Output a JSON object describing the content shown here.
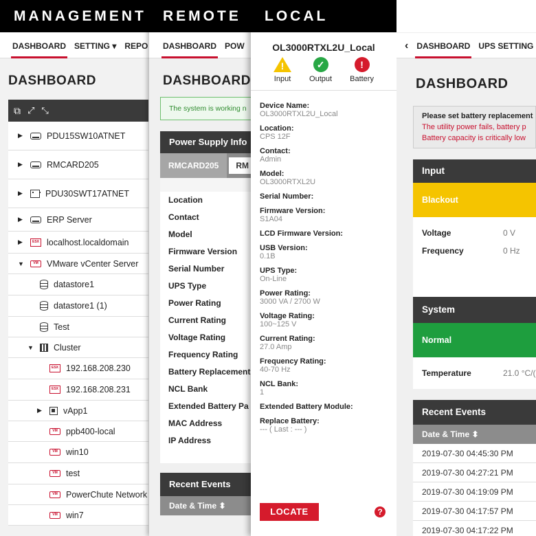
{
  "management": {
    "title": "MANAGEMENT",
    "nav": [
      "DASHBOARD",
      "SETTING ▾",
      "REPO"
    ],
    "heading": "DASHBOARD",
    "tree": [
      {
        "label": "PDU15SW10ATNET",
        "icon": "server-icon",
        "caret": "▶",
        "indent": 0,
        "h": 42
      },
      {
        "label": "RMCARD205",
        "icon": "server-icon",
        "caret": "▶",
        "indent": 0,
        "h": 42
      },
      {
        "label": "PDU30SWT17ATNET",
        "icon": "pdu-icon",
        "caret": "▶",
        "indent": 0,
        "h": 42
      },
      {
        "label": "ERP Server",
        "icon": "server-icon",
        "caret": "▶",
        "indent": 0,
        "h": 34
      },
      {
        "label": "localhost.localdomain",
        "icon": "esx-icon",
        "caret": "▶",
        "indent": 0,
        "h": 32
      },
      {
        "label": "VMware vCenter Server",
        "icon": "vm-icon",
        "caret": "▼",
        "indent": 0,
        "h": 30
      },
      {
        "label": "datastore1",
        "icon": "datastore-icon",
        "caret": "",
        "indent": 1,
        "h": 31
      },
      {
        "label": "datastore1 (1)",
        "icon": "datastore-icon",
        "caret": "",
        "indent": 1,
        "h": 31
      },
      {
        "label": "Test",
        "icon": "datastore-icon",
        "caret": "",
        "indent": 1,
        "h": 30
      },
      {
        "label": "Cluster",
        "icon": "cluster-icon",
        "caret": "▼",
        "indent": 1,
        "h": 30
      },
      {
        "label": "192.168.208.230",
        "icon": "esx-icon",
        "caret": "",
        "indent": 2,
        "h": 31
      },
      {
        "label": "192.168.208.231",
        "icon": "esx-icon",
        "caret": "",
        "indent": 2,
        "h": 31
      },
      {
        "label": "vApp1",
        "icon": "vapp-icon",
        "caret": "▶",
        "indent": 2,
        "h": 30
      },
      {
        "label": "ppb400-local",
        "icon": "vm-icon",
        "caret": "",
        "indent": 2,
        "h": 30
      },
      {
        "label": "win10",
        "icon": "vm-icon",
        "caret": "",
        "indent": 2,
        "h": 31
      },
      {
        "label": "test",
        "icon": "vm-icon",
        "caret": "",
        "indent": 2,
        "h": 31
      },
      {
        "label": "PowerChute Network",
        "icon": "vm-icon",
        "caret": "",
        "indent": 2,
        "h": 30
      },
      {
        "label": "win7",
        "icon": "vm-icon",
        "caret": "",
        "indent": 2,
        "h": 30
      }
    ]
  },
  "remote": {
    "title": "REMOTE",
    "nav": [
      "DASHBOARD",
      "POW"
    ],
    "heading": "DASHBOARD",
    "message": "The system is working n",
    "power_supply_heading": "Power Supply Info",
    "tabs": [
      "RMCARD205",
      "RM"
    ],
    "labels": [
      "Location",
      "Contact",
      "Model",
      "Firmware Version",
      "Serial Number",
      "UPS Type",
      "Power Rating",
      "Current Rating",
      "Voltage Rating",
      "Frequency Rating",
      "Battery Replacement",
      "NCL Bank",
      "Extended Battery Pa",
      "MAC Address",
      "IP Address"
    ],
    "events_heading": "Recent Events",
    "events_col": "Date & Time ⬍"
  },
  "local": {
    "title": "LOCAL",
    "device_title": "OL3000RTXL2U_Local",
    "status": [
      {
        "label": "Input",
        "icon": "warning-icon",
        "color": "#f5c400",
        "glyph": "!"
      },
      {
        "label": "Output",
        "icon": "check-icon",
        "color": "#28a745",
        "glyph": "✓"
      },
      {
        "label": "Battery",
        "icon": "alert-icon",
        "color": "#d51b2c",
        "glyph": "!"
      }
    ],
    "details": [
      {
        "label": "Device Name:",
        "value": "OL3000RTXL2U_Local"
      },
      {
        "label": "Location:",
        "value": "CPS 12F"
      },
      {
        "label": "Contact:",
        "value": "Admin"
      },
      {
        "label": "Model:",
        "value": "OL3000RTXL2U"
      },
      {
        "label": "Serial Number:",
        "value": ""
      },
      {
        "label": "Firmware Version:",
        "value": "S1A04"
      },
      {
        "label": "LCD Firmware Version:",
        "value": ""
      },
      {
        "label": "USB Version:",
        "value": "0.1B"
      },
      {
        "label": "UPS Type:",
        "value": "On-Line"
      },
      {
        "label": "Power Rating:",
        "value": "3000 VA / 2700 W"
      },
      {
        "label": "Voltage Rating:",
        "value": "100~125 V"
      },
      {
        "label": "Current Rating:",
        "value": "27.0 Amp"
      },
      {
        "label": "Frequency Rating:",
        "value": "40-70 Hz"
      },
      {
        "label": "NCL Bank:",
        "value": "1"
      },
      {
        "label": "Extended Battery Module:",
        "value": ""
      },
      {
        "label": "Replace Battery:",
        "value": "--- ( Last : --- )"
      }
    ],
    "locate_label": "LOCATE",
    "help_glyph": "?"
  },
  "dashboard": {
    "nav": [
      "DASHBOARD",
      "UPS SETTING"
    ],
    "heading": "DASHBOARD",
    "warning_title": "Please set battery replacement",
    "warnings": [
      "The utility power fails, battery p",
      "Battery capacity is critically low"
    ],
    "input_heading": "Input",
    "input_status": "Blackout",
    "input_rows": [
      {
        "label": "Voltage",
        "value": "0 V"
      },
      {
        "label": "Frequency",
        "value": "0 Hz"
      }
    ],
    "system_heading": "System",
    "system_status": "Normal",
    "system_rows": [
      {
        "label": "Temperature",
        "value": "21.0 °C/("
      }
    ],
    "events_heading": "Recent Events",
    "events_col": "Date & Time ⬍",
    "events": [
      "2019-07-30 04:45:30 PM",
      "2019-07-30 04:27:21 PM",
      "2019-07-30 04:19:09 PM",
      "2019-07-30 04:17:57 PM",
      "2019-07-30 04:17:22 PM"
    ],
    "colors": {
      "blackout": "#f5c400",
      "normal": "#1e9e3e",
      "accent": "#c8102e"
    }
  }
}
